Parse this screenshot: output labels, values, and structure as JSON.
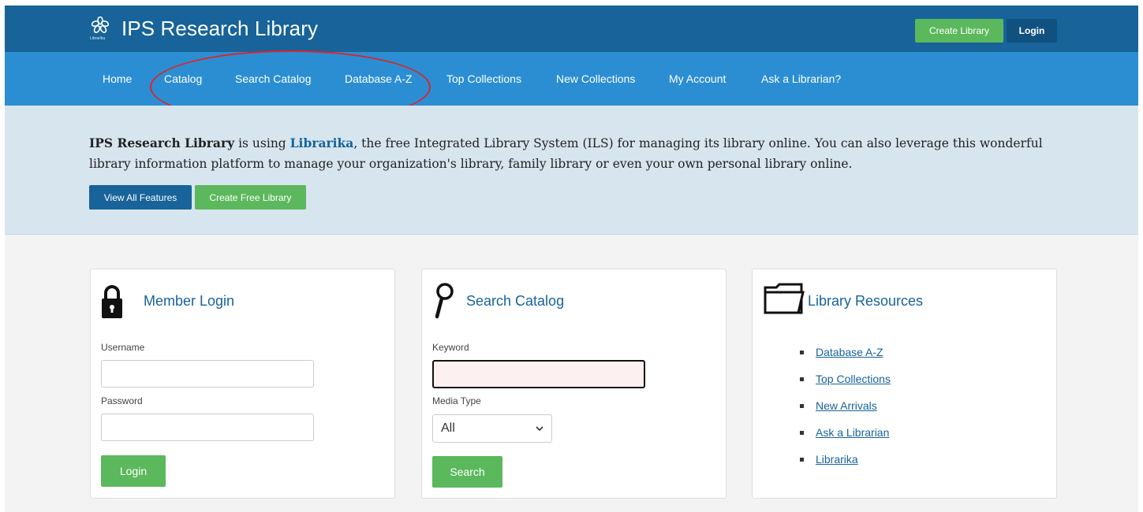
{
  "header": {
    "logo_icon": "librarika-flower-icon",
    "logo_text": "Librarika",
    "title": "IPS Research Library",
    "create_library_label": "Create Library",
    "login_label": "Login"
  },
  "nav": {
    "items": [
      {
        "label": "Home"
      },
      {
        "label": "Catalog"
      },
      {
        "label": "Search Catalog"
      },
      {
        "label": "Database A-Z"
      },
      {
        "label": "Top Collections"
      },
      {
        "label": "New Collections"
      },
      {
        "label": "My Account"
      },
      {
        "label": "Ask a Librarian?"
      }
    ]
  },
  "hero": {
    "library_name": "IPS Research Library",
    "text_1": " is using ",
    "platform": "Librarika",
    "text_2": ", the free Integrated Library System (ILS) for managing its library online. You can also leverage this wonderful library information platform to manage your organization's library, family library or even your own personal library online.",
    "view_features_label": "View All Features",
    "create_free_label": "Create Free Library"
  },
  "login_card": {
    "icon": "padlock-icon",
    "title": "Member Login",
    "username_label": "Username",
    "username_value": "",
    "password_label": "Password",
    "password_value": "",
    "submit_label": "Login"
  },
  "search_card": {
    "icon": "magnifier-icon",
    "title": "Search Catalog",
    "keyword_label": "Keyword",
    "keyword_value": "",
    "media_type_label": "Media Type",
    "media_type_value": "All",
    "submit_label": "Search"
  },
  "resources_card": {
    "icon": "folder-icon",
    "title": "Library Resources",
    "links": [
      {
        "label": "Database A-Z"
      },
      {
        "label": "Top Collections"
      },
      {
        "label": "New Arrivals"
      },
      {
        "label": "Ask a Librarian"
      },
      {
        "label": "Librarika"
      }
    ]
  },
  "colors": {
    "header_bg": "#17639a",
    "nav_bg": "#2b8ed3",
    "hero_bg": "#d7e5ef",
    "accent_green": "#5cb85c",
    "annotation_red": "#d9262b"
  }
}
